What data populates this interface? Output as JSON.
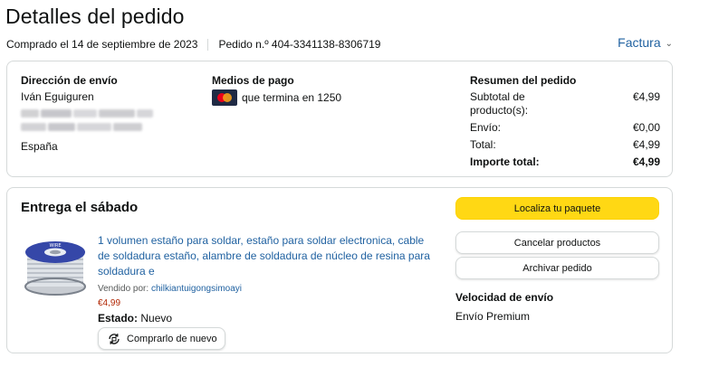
{
  "page": {
    "title": "Detalles del pedido",
    "purchased": "Comprado el 14 de septiembre de 2023",
    "order": "Pedido n.º 404-3341138-8306719",
    "invoice": "Factura"
  },
  "shipping": {
    "heading": "Dirección de envío",
    "name": "Iván Eguiguren",
    "country": "España"
  },
  "payment": {
    "heading": "Medios de pago",
    "card_text": "que termina en 1250",
    "card_icon": "mastercard-icon"
  },
  "summary": {
    "heading": "Resumen del pedido",
    "rows": [
      {
        "label": "Subtotal de producto(s):",
        "value": "€4,99"
      },
      {
        "label": "Envío:",
        "value": "€0,00"
      },
      {
        "label": "Total:",
        "value": "€4,99"
      },
      {
        "label": "Importe total:",
        "value": "€4,99"
      }
    ]
  },
  "delivery": {
    "title": "Entrega el sábado",
    "product": {
      "title": "1 volumen estaño para soldar, estaño para soldar electronica, cable de soldadura estaño, alambre de soldadura de núcleo de resina para soldadura e",
      "sold_by_label": "Vendido por:",
      "seller": "chilkiantuigongsimoayi",
      "price": "€4,99",
      "status_label": "Estado:",
      "status_value": "Nuevo",
      "buy_again": "Comprarlo de nuevo"
    },
    "buttons": {
      "track": "Localiza tu paquete",
      "cancel": "Cancelar productos",
      "archive": "Archivar pedido"
    },
    "speed_heading": "Velocidad de envío",
    "speed_value": "Envío Premium"
  },
  "colors": {
    "link": "#2162a1",
    "price": "#b12704",
    "primary_button": "#ffd814"
  }
}
